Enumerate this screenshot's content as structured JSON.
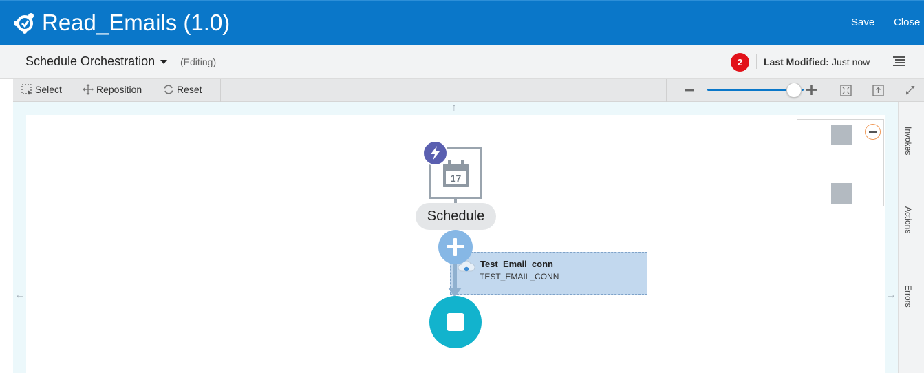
{
  "app": {
    "title": "Read_Emails (1.0)",
    "save_label": "Save",
    "close_label": "Close",
    "brand_color": "#0a77c9"
  },
  "subheader": {
    "breadcrumb": "Schedule Orchestration",
    "status": "(Editing)",
    "notification_count": "2",
    "last_modified_label": "Last Modified:",
    "last_modified_value": "Just now"
  },
  "toolbar": {
    "select_label": "Select",
    "reposition_label": "Reposition",
    "reset_label": "Reset",
    "zoom_level": 0.9
  },
  "side_tabs": {
    "invokes": "Invokes",
    "actions": "Actions",
    "errors": "Errors"
  },
  "flow": {
    "trigger_label": "Schedule",
    "calendar_day": "17",
    "connection_name": "Test_Email_conn",
    "connection_code": "TEST_EMAIL_CONN"
  },
  "icons": {
    "logo": "integration-logo-icon",
    "menu": "hamburger-menu-icon",
    "select": "marquee-select-icon",
    "reposition": "move-arrows-icon",
    "reset": "refresh-icon",
    "zoom_out": "minus-icon",
    "zoom_in": "plus-icon",
    "fit": "fit-to-screen-icon",
    "export": "export-icon",
    "expand": "expand-icon"
  }
}
